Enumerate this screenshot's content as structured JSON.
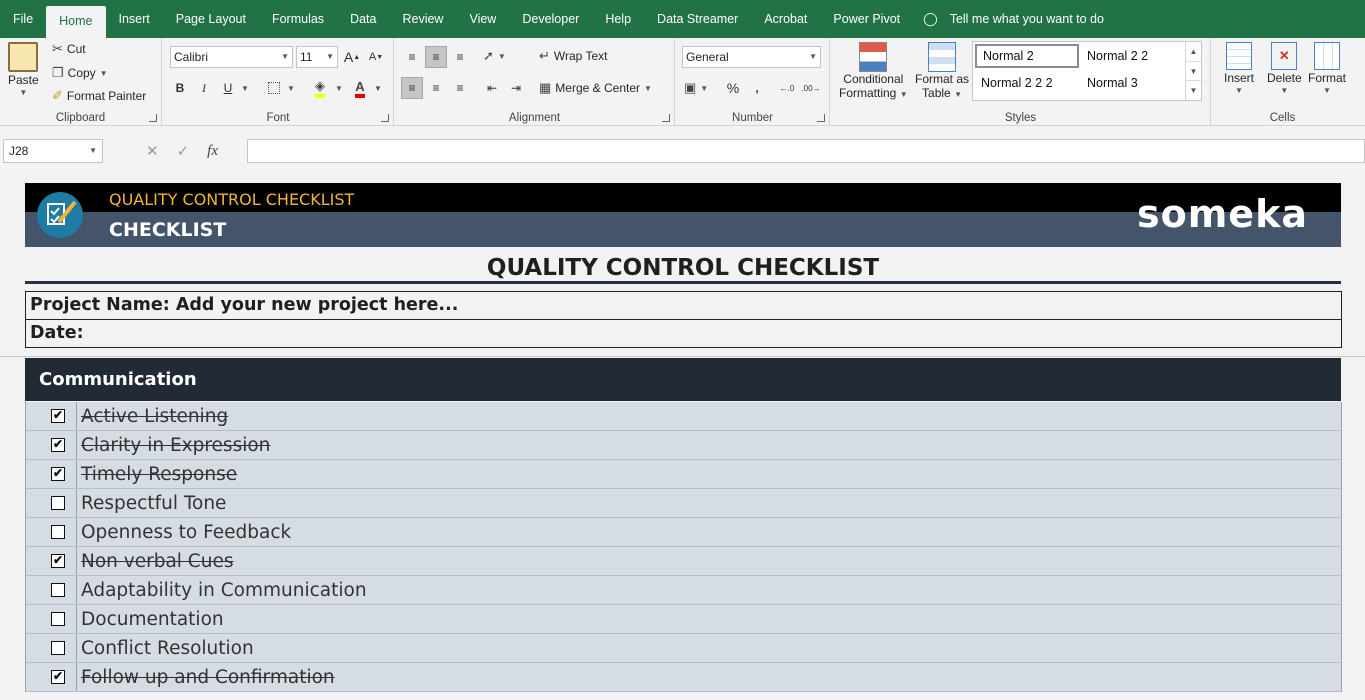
{
  "ribbon_tabs": [
    "File",
    "Home",
    "Insert",
    "Page Layout",
    "Formulas",
    "Data",
    "Review",
    "View",
    "Developer",
    "Help",
    "Data Streamer",
    "Acrobat",
    "Power Pivot"
  ],
  "tell_me": "Tell me what you want to do",
  "clipboard": {
    "paste": "Paste",
    "cut": "Cut",
    "copy": "Copy",
    "format_painter": "Format Painter",
    "label": "Clipboard"
  },
  "font": {
    "name": "Calibri",
    "size": "11",
    "label": "Font"
  },
  "alignment": {
    "wrap": "Wrap Text",
    "merge": "Merge & Center",
    "label": "Alignment"
  },
  "number": {
    "format": "General",
    "label": "Number"
  },
  "styles": {
    "conditional": [
      "Conditional",
      "Formatting"
    ],
    "format_table": [
      "Format as",
      "Table"
    ],
    "gallery": [
      "Normal 2",
      "Normal 2 2",
      "Normal 2 2 2",
      "Normal 3"
    ],
    "label": "Styles"
  },
  "cells": {
    "insert": "Insert",
    "delete": "Delete",
    "format": "Format",
    "label": "Cells"
  },
  "formula_bar": {
    "name_box": "J28",
    "formula": ""
  },
  "sheet": {
    "banner_subtitle": "QUALITY CONTROL CHECKLIST",
    "banner_title": "CHECKLIST",
    "brand": "someka",
    "title": "QUALITY CONTROL CHECKLIST",
    "project_name": "Project Name: Add your new project here...",
    "date_label": "Date:",
    "section": "Communication",
    "items": [
      {
        "label": "Active Listening",
        "checked": true
      },
      {
        "label": "Clarity in Expression",
        "checked": true
      },
      {
        "label": "Timely Response",
        "checked": true
      },
      {
        "label": "Respectful Tone",
        "checked": false
      },
      {
        "label": "Openness to Feedback",
        "checked": false
      },
      {
        "label": "Non verbal Cues",
        "checked": true
      },
      {
        "label": "Adaptability in Communication",
        "checked": false
      },
      {
        "label": "Documentation",
        "checked": false
      },
      {
        "label": "Conflict Resolution",
        "checked": false
      },
      {
        "label": "Follow up and Confirmation",
        "checked": true
      }
    ]
  }
}
